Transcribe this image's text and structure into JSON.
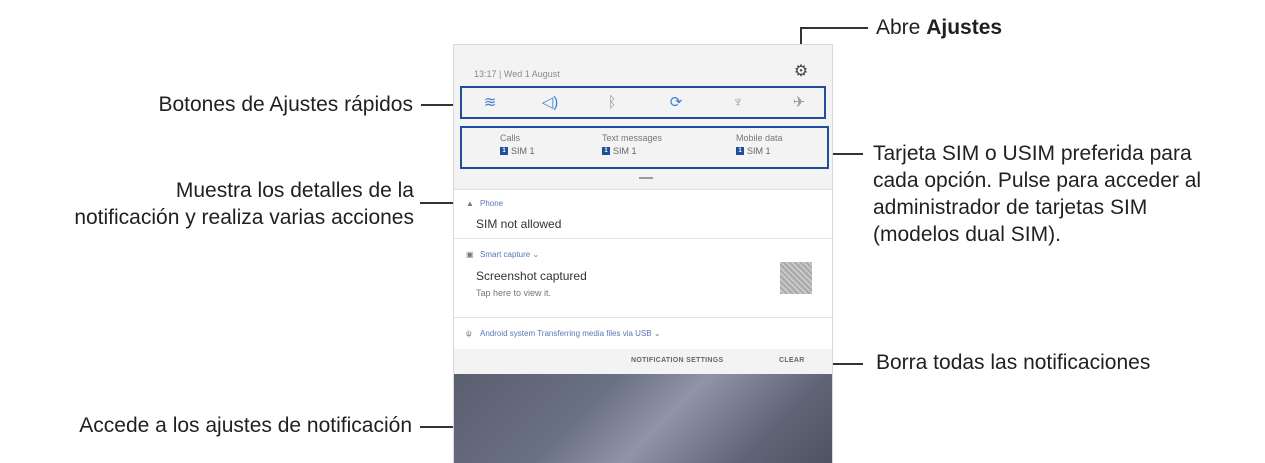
{
  "callouts": {
    "open_settings_prefix": "Abre ",
    "open_settings_bold": "Ajustes",
    "quick_settings": "Botones de Ajustes rápidos",
    "sim_pref_line1": "Tarjeta SIM o USIM preferida para",
    "sim_pref_line2": "cada opción. Pulse para acceder al",
    "sim_pref_line3": "administrador de tarjetas SIM",
    "sim_pref_line4": "(modelos dual SIM).",
    "notif_details_line1": "Muestra los detalles de la",
    "notif_details_line2": "notificación y realiza varias acciones",
    "clear_all": "Borra todas las notificaciones",
    "notif_settings": "Accede a los ajustes de notificación"
  },
  "phone": {
    "status_text": "13:17 | Wed 1 August",
    "quick_settings": [
      {
        "icon": "wifi-icon",
        "glyph": "≋",
        "active": true
      },
      {
        "icon": "sound-icon",
        "glyph": "◁)",
        "active": true
      },
      {
        "icon": "bluetooth-icon",
        "glyph": "ᛒ",
        "active": false
      },
      {
        "icon": "auto-rotate-icon",
        "glyph": "⟳",
        "active": true
      },
      {
        "icon": "flashlight-icon",
        "glyph": "♆",
        "active": false
      },
      {
        "icon": "airplane-icon",
        "glyph": "✈",
        "active": false
      }
    ],
    "sim": [
      {
        "label": "Calls",
        "value": "SIM 1"
      },
      {
        "label": "Text messages",
        "value": "SIM 1"
      },
      {
        "label": "Mobile data",
        "value": "SIM 1"
      }
    ],
    "sim_badge": "1",
    "notifications": [
      {
        "app": "Phone",
        "title": "SIM not allowed",
        "sub": ""
      },
      {
        "app": "Smart capture ⌄",
        "title": "Screenshot captured",
        "sub": "Tap here to view it."
      },
      {
        "app": "Android system  Transferring media files via USB ⌄",
        "title": "",
        "sub": ""
      }
    ],
    "notification_settings": "NOTIFICATION SETTINGS",
    "clear": "CLEAR"
  },
  "colors": {
    "accent": "#1f4e9b",
    "active_icon": "#3f7fd6"
  }
}
